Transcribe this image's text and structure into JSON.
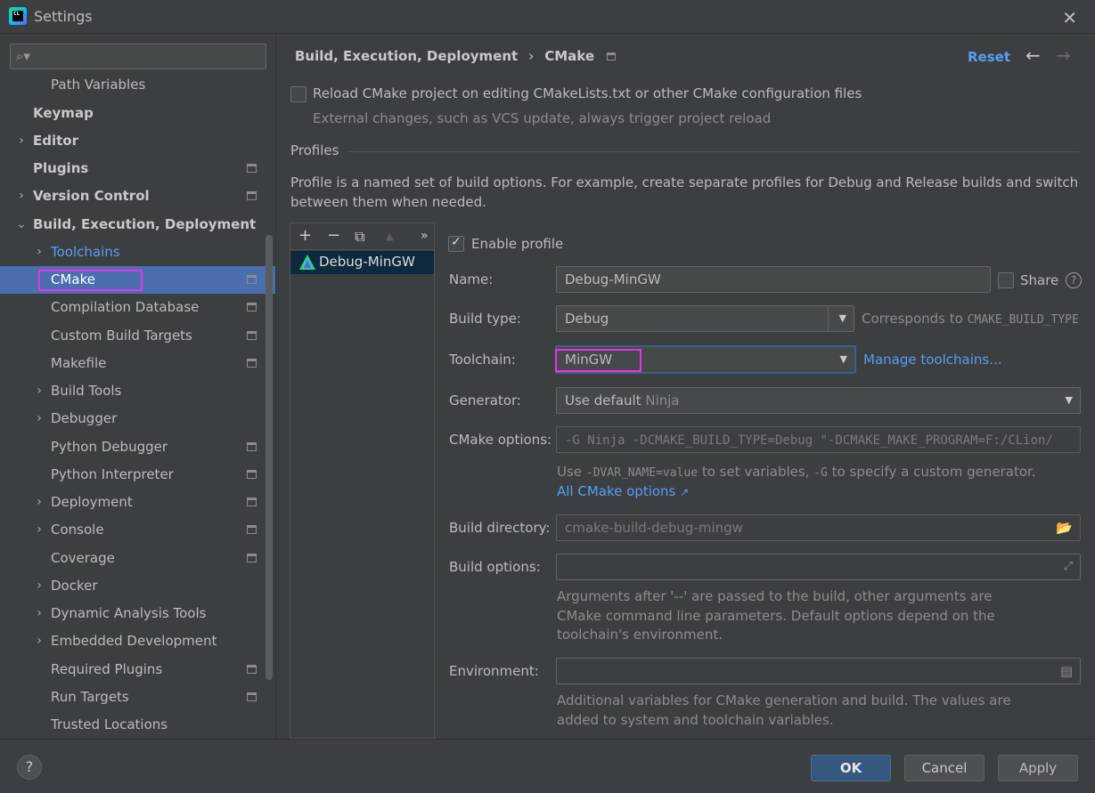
{
  "window": {
    "title": "Settings",
    "icon_text": "CL"
  },
  "sidebar": {
    "search_placeholder": "",
    "items": [
      {
        "label": "Path Variables"
      },
      {
        "label": "Keymap"
      },
      {
        "label": "Editor"
      },
      {
        "label": "Plugins"
      },
      {
        "label": "Version Control"
      },
      {
        "label": "Build, Execution, Deployment"
      },
      {
        "label": "Toolchains"
      },
      {
        "label": "CMake"
      },
      {
        "label": "Compilation Database"
      },
      {
        "label": "Custom Build Targets"
      },
      {
        "label": "Makefile"
      },
      {
        "label": "Build Tools"
      },
      {
        "label": "Debugger"
      },
      {
        "label": "Python Debugger"
      },
      {
        "label": "Python Interpreter"
      },
      {
        "label": "Deployment"
      },
      {
        "label": "Console"
      },
      {
        "label": "Coverage"
      },
      {
        "label": "Docker"
      },
      {
        "label": "Dynamic Analysis Tools"
      },
      {
        "label": "Embedded Development"
      },
      {
        "label": "Required Plugins"
      },
      {
        "label": "Run Targets"
      },
      {
        "label": "Trusted Locations"
      }
    ]
  },
  "header": {
    "crumb_parent": "Build, Execution, Deployment",
    "crumb_sep": "›",
    "crumb_current": "CMake",
    "reset": "Reset",
    "back_icon": "←",
    "forward_icon": "→"
  },
  "reload": {
    "label": "Reload CMake project on editing CMakeLists.txt or other CMake configuration files",
    "hint": "External changes, such as VCS update, always trigger project reload"
  },
  "profiles": {
    "section_title": "Profiles",
    "description_line1": "Profile is a named set of build options. For example, create separate profiles for Debug and Release builds and switch",
    "description_line2": "between them when needed.",
    "toolbar": {
      "add": "+",
      "remove": "−",
      "copy": "⧉",
      "up": "▲",
      "more": "»"
    },
    "list": [
      {
        "name": "Debug-MinGW"
      }
    ]
  },
  "form": {
    "enable_profile": "Enable profile",
    "name_label": "Name:",
    "name_value": "Debug-MinGW",
    "share_label": "Share",
    "help_icon": "?",
    "build_type_label": "Build type:",
    "build_type_value": "Debug",
    "build_type_hint": "Corresponds to",
    "build_type_var": "CMAKE_BUILD_TYPE",
    "toolchain_label": "Toolchain:",
    "toolchain_value": "MinGW",
    "manage_toolchains": "Manage toolchains...",
    "generator_label": "Generator:",
    "generator_value": "Use default",
    "generator_hint": "Ninja",
    "cmake_options_label": "CMake options:",
    "cmake_options_value": "-G Ninja -DCMAKE_BUILD_TYPE=Debug \"-DCMAKE_MAKE_PROGRAM=F:/CLion/",
    "cmake_hint_use": "Use",
    "cmake_hint_var": "-DVAR_NAME=value",
    "cmake_hint_mid": "to set variables,",
    "cmake_hint_g": "-G",
    "cmake_hint_end": "to specify a custom generator.",
    "all_cmake_options": "All CMake options",
    "build_dir_label": "Build directory:",
    "build_dir_value": "cmake-build-debug-mingw",
    "build_options_label": "Build options:",
    "build_options_value": "",
    "build_options_hint_1": "Arguments after '--' are passed to the build, other arguments are",
    "build_options_hint_2": "CMake command line parameters. Default options depend on the",
    "build_options_hint_3": "toolchain's environment.",
    "environment_label": "Environment:",
    "environment_value": "",
    "environment_hint_1": "Additional variables for CMake generation and build. The values are",
    "environment_hint_2": "added to system and toolchain variables."
  },
  "footer": {
    "help": "?",
    "ok": "OK",
    "cancel": "Cancel",
    "apply": "Apply"
  },
  "colors": {
    "accent": "#589df6",
    "selection": "#4b6eaf",
    "highlight_box": "#e535e5",
    "primary_button": "#365880"
  }
}
